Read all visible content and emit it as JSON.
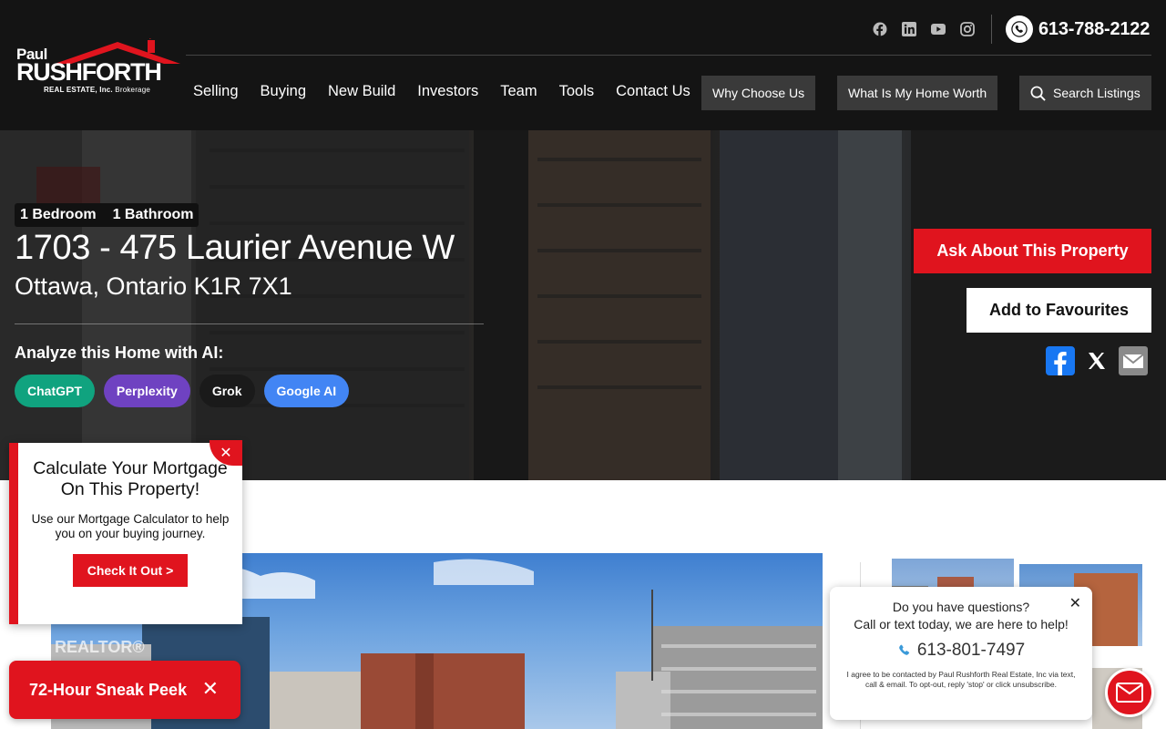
{
  "brand": {
    "name_top": "Paul",
    "name_main": "RUSHFORTH",
    "name_sub": "REAL ESTATE, Inc.",
    "name_sub2": "Brokerage",
    "accent_color": "#e0141e"
  },
  "header": {
    "social_icons": [
      "facebook-icon",
      "linkedin-icon",
      "youtube-icon",
      "instagram-icon"
    ],
    "phone": "613-788-2122",
    "nav": [
      "Selling",
      "Buying",
      "New Build",
      "Investors",
      "Team",
      "Tools",
      "Contact Us"
    ],
    "why_choose": "Why Choose Us",
    "home_worth": "What Is My Home Worth",
    "search_listings": "Search Listings"
  },
  "listing": {
    "bedrooms": "1 Bedroom",
    "bathrooms": "1 Bathroom",
    "address": "1703 - 475 Laurier Avenue W",
    "city": "Ottawa, Ontario K1R 7X1",
    "ai_label": "Analyze this Home with AI:",
    "ai_buttons": [
      {
        "label": "ChatGPT",
        "color": "#10a37f"
      },
      {
        "label": "Perplexity",
        "color": "#6f42c1"
      },
      {
        "label": "Grok",
        "color": "#1a1a1a"
      },
      {
        "label": "Google AI",
        "color": "#4285f4"
      }
    ],
    "ask_button": " Ask About This Property",
    "fav_button": " Add to Favourites",
    "share_icons": [
      "facebook-share-icon",
      "x-share-icon",
      "email-share-icon"
    ]
  },
  "photos": {
    "watermark": "REALTOR®"
  },
  "mortgage_popup": {
    "title": "Calculate Your Mortgage On This Property!",
    "body": "Use our Mortgage Calculator to help you on your buying journey.",
    "cta": "Check It Out >",
    "close": "✕"
  },
  "sneak_peek": {
    "label": "72-Hour Sneak Peek",
    "close": "✕"
  },
  "chat_popup": {
    "question": "Do you have questions?",
    "prompt": "Call or text today, we are here to help!",
    "phone": "613-801-7497",
    "disclaimer": "I agree to be contacted by Paul Rushforth Real Estate, Inc via text, call & email. To opt-out, reply 'stop' or click unsubscribe.",
    "close": "✕"
  }
}
